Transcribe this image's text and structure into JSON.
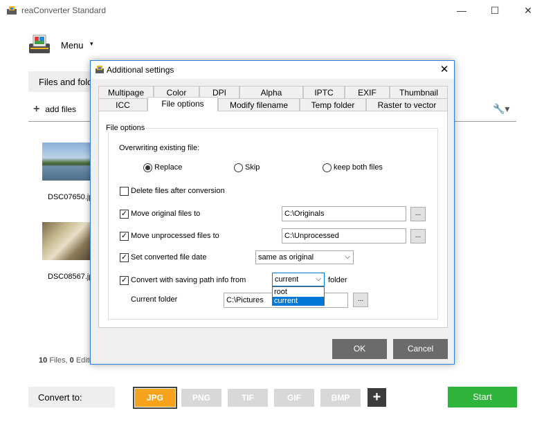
{
  "app": {
    "title": "reaConverter Standard",
    "window_controls": {
      "minimize": "—",
      "maximize": "☐",
      "close": "✕"
    }
  },
  "menu": {
    "label": "Menu",
    "caret": "▾"
  },
  "files_tab": {
    "label": "Files and folders"
  },
  "toolbar": {
    "add_files_icon": "+",
    "add_files_label": "add files",
    "wrench_icon": "🔧▾"
  },
  "thumbnails": [
    {
      "name": "DSC07650.jpg"
    },
    {
      "name": "DSC08567.jpg"
    }
  ],
  "status": {
    "count": "10",
    "files_label": "Files,",
    "edits_count": "0",
    "edits_label": "Editing actions"
  },
  "convert_to": {
    "label": "Convert to:"
  },
  "formats": [
    {
      "label": "JPG",
      "active": true
    },
    {
      "label": "PNG",
      "active": false
    },
    {
      "label": "TIF",
      "active": false
    },
    {
      "label": "GIF",
      "active": false
    },
    {
      "label": "BMP",
      "active": false
    }
  ],
  "add_format": "+",
  "start_button": "Start",
  "dialog": {
    "title": "Additional settings",
    "close": "✕",
    "tabs_row1": [
      "Multipage",
      "Color",
      "DPI",
      "Alpha",
      "IPTC",
      "EXIF",
      "Thumbnail"
    ],
    "tabs_row2": [
      "ICC",
      "File options",
      "Modify filename",
      "Temp folder",
      "Raster to vector"
    ],
    "selected_tab": "File options",
    "group_title": "File options",
    "overwriting_label": "Overwriting existing file:",
    "overwrite_options": [
      "Replace",
      "Skip",
      "keep both files"
    ],
    "overwrite_selected": "Replace",
    "delete_after": {
      "label": "Delete files after conversion",
      "checked": false
    },
    "move_original": {
      "label": "Move original files to",
      "checked": true,
      "value": "C:\\Originals",
      "browse": "..."
    },
    "move_unprocessed": {
      "label": "Move unprocessed files to",
      "checked": true,
      "value": "C:\\Unprocessed",
      "browse": "..."
    },
    "set_date": {
      "label": "Set converted file date",
      "checked": true,
      "value": "same as original"
    },
    "convert_path": {
      "label": "Convert with saving path info from",
      "checked": true,
      "value": "current",
      "suffix": "folder",
      "options": [
        "root",
        "current"
      ],
      "highlighted": "current"
    },
    "current_folder": {
      "label": "Current folder",
      "value": "C:\\Pictures",
      "browse": "..."
    },
    "ok": "OK",
    "cancel": "Cancel"
  },
  "colors": {
    "accent_blue": "#0078d7",
    "format_active": "#f7a21b",
    "start_green": "#2fb53b",
    "dialog_button": "#6b6b6b"
  }
}
